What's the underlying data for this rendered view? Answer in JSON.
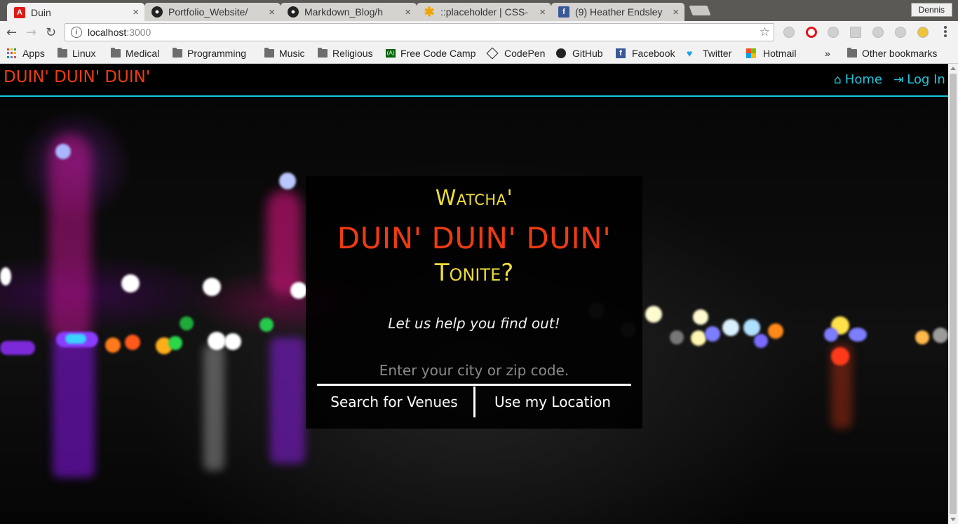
{
  "browser": {
    "tabs": [
      {
        "title": "Duin",
        "icon": "angular-icon",
        "active": true
      },
      {
        "title": "Portfolio_Website/",
        "icon": "github-icon",
        "active": false
      },
      {
        "title": "Markdown_Blog/h",
        "icon": "github-icon",
        "active": false
      },
      {
        "title": "::placeholder | CSS-",
        "icon": "css-tricks-icon",
        "active": false
      },
      {
        "title": "(9) Heather Endsley",
        "icon": "facebook-icon",
        "active": false
      }
    ],
    "tab_close": "×",
    "profile_name": "Dennis",
    "url_host": "localhost",
    "url_port": ":3000",
    "back_icon": "←",
    "forward_icon": "→",
    "reload_icon": "↻",
    "star_icon": "☆",
    "info_icon": "i",
    "bookmarks": [
      {
        "label": "Apps",
        "icon": "apps-grid-icon"
      },
      {
        "label": "Linux",
        "icon": "folder-icon"
      },
      {
        "label": "Medical",
        "icon": "folder-icon"
      },
      {
        "label": "Programming",
        "icon": "folder-icon"
      },
      {
        "label": "Music",
        "icon": "folder-icon"
      },
      {
        "label": "Religious",
        "icon": "folder-icon"
      },
      {
        "label": "Free Code Camp",
        "icon": "freecodecamp-icon"
      },
      {
        "label": "CodePen",
        "icon": "codepen-icon"
      },
      {
        "label": "GitHub",
        "icon": "github-icon"
      },
      {
        "label": "Facebook",
        "icon": "facebook-icon"
      },
      {
        "label": "Twitter",
        "icon": "twitter-icon"
      },
      {
        "label": "Hotmail",
        "icon": "microsoft-icon"
      }
    ],
    "bookmarks_overflow": "»",
    "other_bookmarks": "Other bookmarks"
  },
  "navbar": {
    "brand": "DUIN' DUIN' DUIN'",
    "home_label": "Home",
    "login_label": "Log In",
    "accent_color": "#1fc6dc",
    "brand_color": "#ee3b12"
  },
  "hero": {
    "watcha": "Watcha'",
    "duin": "DUIN' DUIN' DUIN'",
    "tonite": "Tonite?",
    "tagline": "Let us help you find out!",
    "city_placeholder": "Enter your city or zip code.",
    "city_value": "",
    "search_button": "Search for Venues",
    "location_button": "Use my Location",
    "yellow_color": "#ecdc3a"
  }
}
